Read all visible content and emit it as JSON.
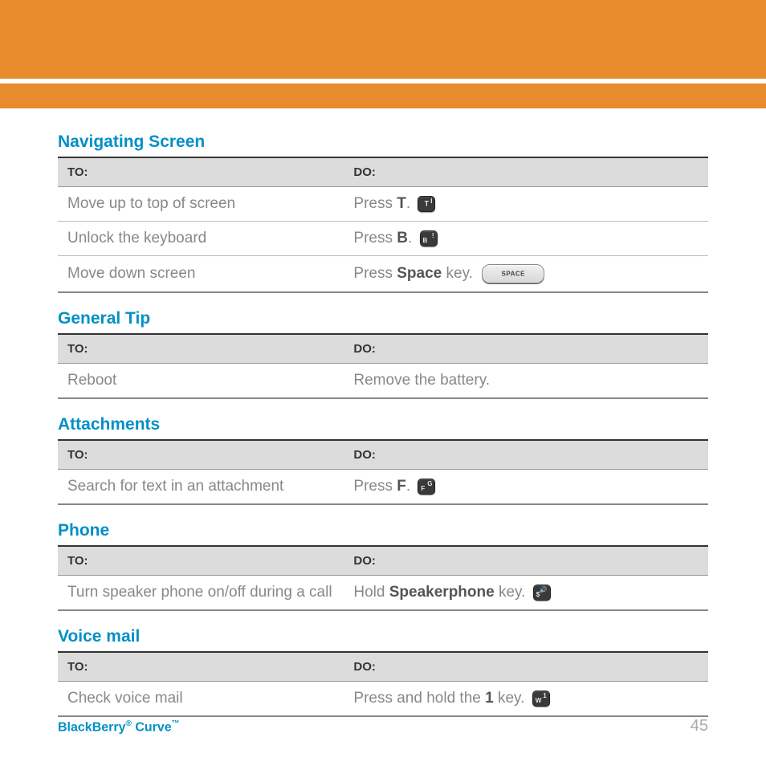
{
  "headers": {
    "to": "TO:",
    "do": "DO:"
  },
  "sections": [
    {
      "title": "Navigating Screen",
      "rows": [
        {
          "to": "Move up to top of screen",
          "do_pre": "Press ",
          "do_bold": "T",
          "do_post": ". ",
          "key": "T"
        },
        {
          "to": "Unlock the keyboard",
          "do_pre": "Press ",
          "do_bold": "B",
          "do_post": ". ",
          "key": "B"
        },
        {
          "to": "Move down screen",
          "do_pre": "Press ",
          "do_bold": "Space",
          "do_post": " key. ",
          "key": "SPACE"
        }
      ]
    },
    {
      "title": "General Tip",
      "rows": [
        {
          "to": "Reboot",
          "do_pre": "Remove the battery.",
          "do_bold": "",
          "do_post": "",
          "key": ""
        }
      ]
    },
    {
      "title": "Attachments",
      "rows": [
        {
          "to": "Search for text in an attachment",
          "do_pre": "Press ",
          "do_bold": "F",
          "do_post": ". ",
          "key": "F"
        }
      ]
    },
    {
      "title": "Phone",
      "rows": [
        {
          "to": "Turn speaker phone on/off during a call",
          "do_pre": "Hold ",
          "do_bold": "Speakerphone",
          "do_post": " key. ",
          "key": "SPK"
        }
      ]
    },
    {
      "title": "Voice mail",
      "rows": [
        {
          "to": "Check voice mail",
          "do_pre": "Press and hold the ",
          "do_bold": "1",
          "do_post": " key. ",
          "key": "1"
        }
      ]
    }
  ],
  "footer": {
    "brand_pre": "BlackBerry",
    "reg": "®",
    "brand_post": " Curve",
    "tm": "™",
    "page": "45"
  }
}
